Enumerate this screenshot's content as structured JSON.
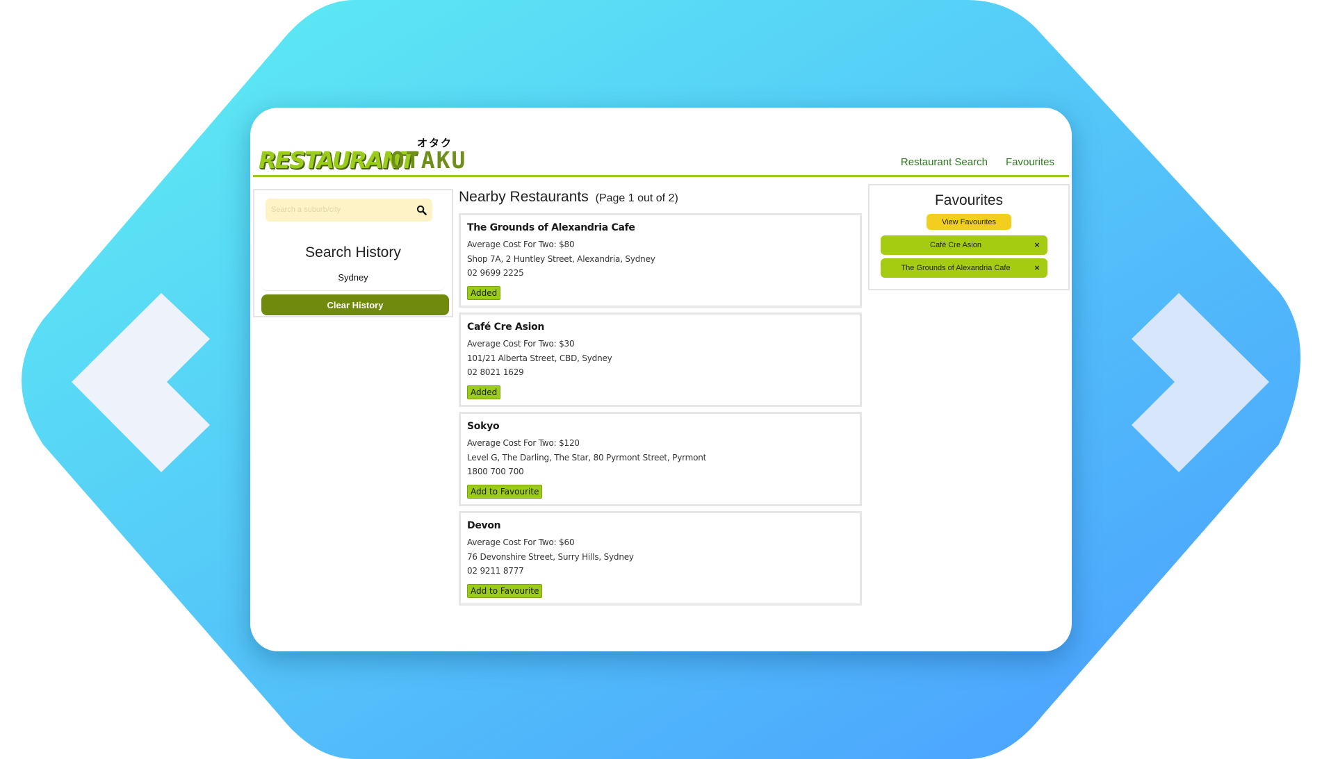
{
  "app": {
    "logo_main": "RESTAURANT",
    "logo_otaku": "OTAKU",
    "logo_kana": "オタク"
  },
  "nav": {
    "items": [
      {
        "label": "Restaurant Search"
      },
      {
        "label": "Favourites"
      }
    ]
  },
  "sidebar": {
    "search_placeholder": "Search a suburb/city",
    "search_icon": "search-icon",
    "history_title": "Search History",
    "history_items": [
      "Sydney"
    ],
    "clear_button": "Clear History"
  },
  "results": {
    "heading": "Nearby Restaurants",
    "page_info": "(Page 1 out of 2)",
    "restaurants": [
      {
        "name": "The Grounds of Alexandria Cafe",
        "cost": "Average Cost For Two: $80",
        "address": "Shop 7A, 2 Huntley Street, Alexandria, Sydney",
        "phone": "02 9699 2225",
        "action": "Added"
      },
      {
        "name": "Café Cre Asion",
        "cost": "Average Cost For Two: $30",
        "address": "101/21 Alberta Street, CBD, Sydney",
        "phone": "02 8021 1629",
        "action": "Added"
      },
      {
        "name": "Sokyo",
        "cost": "Average Cost For Two: $120",
        "address": "Level G, The Darling, The Star, 80 Pyrmont Street, Pyrmont",
        "phone": "1800 700 700",
        "action": "Add to Favourite"
      },
      {
        "name": "Devon",
        "cost": "Average Cost For Two: $60",
        "address": "76 Devonshire Street, Surry Hills, Sydney",
        "phone": "02 9211 8777",
        "action": "Add to Favourite"
      }
    ]
  },
  "favourites": {
    "title": "Favourites",
    "view_button": "View Favourites",
    "items": [
      {
        "label": "Café Cre Asion",
        "remove": "×"
      },
      {
        "label": "The Grounds of Alexandria Cafe",
        "remove": "×"
      }
    ]
  },
  "colors": {
    "accent_green": "#9ccc1a",
    "dark_green": "#6f8a0d",
    "link_green": "#2f7a1f",
    "yellow": "#f2cf1f",
    "background_gradient_start": "#5ee9f2",
    "background_gradient_end": "#4aa3ff"
  }
}
